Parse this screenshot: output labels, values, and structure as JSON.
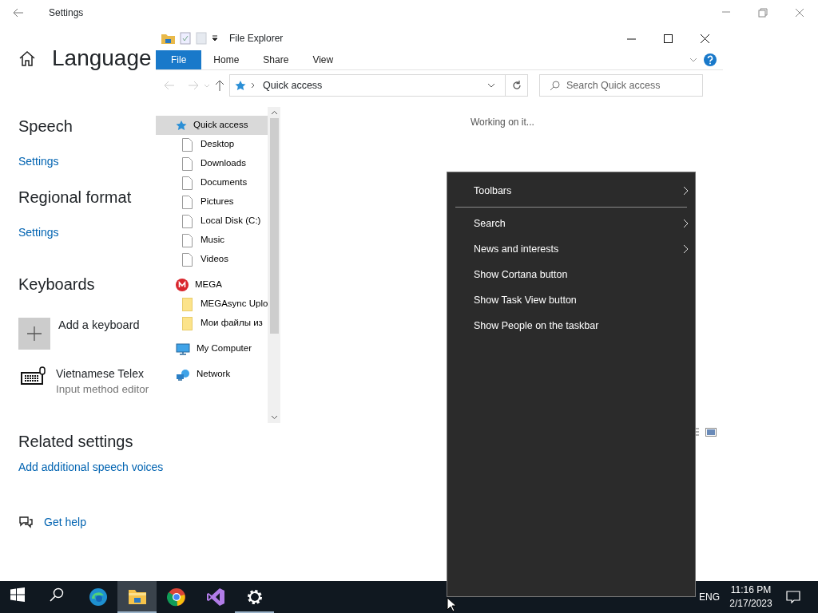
{
  "settings": {
    "title": "Settings",
    "heading": "Language",
    "items": [
      {
        "kind": "section",
        "text": "Speech"
      },
      {
        "kind": "link",
        "text": "Settings"
      },
      {
        "kind": "section",
        "text": "Regional format"
      },
      {
        "kind": "link",
        "text": "Settings"
      },
      {
        "kind": "section",
        "text": "Keyboards"
      },
      {
        "kind": "add",
        "text": "Add a keyboard"
      },
      {
        "kind": "keyboard",
        "text": "Vietnamese Telex",
        "subtext": "Input method editor"
      },
      {
        "kind": "section",
        "text": "Related settings"
      },
      {
        "kind": "link",
        "text": "Add additional speech voices"
      },
      {
        "kind": "help",
        "text": "Get help"
      }
    ]
  },
  "explorer": {
    "title": "File Explorer",
    "ribbon_tabs": [
      {
        "label": "File",
        "selected": true
      },
      {
        "label": "Home",
        "selected": false
      },
      {
        "label": "Share",
        "selected": false
      },
      {
        "label": "View",
        "selected": false
      }
    ],
    "address": "Quick access",
    "search_placeholder": "Search Quick access",
    "status": "Working on it...",
    "nav": [
      {
        "label": "Quick access",
        "selected": true,
        "children": [
          {
            "label": "Desktop",
            "selected": false
          },
          {
            "label": "Downloads",
            "selected": false
          },
          {
            "label": "Documents",
            "selected": false
          },
          {
            "label": "Pictures",
            "selected": false
          },
          {
            "label": "Local Disk (C:)",
            "selected": false
          },
          {
            "label": "Music",
            "selected": false
          },
          {
            "label": "Videos",
            "selected": false
          }
        ]
      },
      {
        "label": "MEGA",
        "selected": false,
        "children": [
          {
            "label": "MEGAsync Uplo",
            "selected": false
          },
          {
            "label": "Мои файлы из",
            "selected": false
          }
        ]
      },
      {
        "label": "My Computer",
        "selected": false
      },
      {
        "label": "Network",
        "selected": false
      }
    ]
  },
  "context_menu": {
    "items": [
      {
        "kind": "submenu",
        "label": "Toolbars"
      },
      {
        "kind": "separator"
      },
      {
        "kind": "submenu",
        "label": "Search"
      },
      {
        "kind": "submenu",
        "label": "News and interests"
      },
      {
        "kind": "command",
        "label": "Show Cortana button"
      },
      {
        "kind": "command",
        "label": "Show Task View button"
      },
      {
        "kind": "command",
        "label": "Show People on the taskbar"
      }
    ]
  },
  "taskbar": {
    "apps": [
      {
        "kind": "start",
        "selected": false,
        "running": false
      },
      {
        "kind": "search",
        "selected": false,
        "running": false
      },
      {
        "kind": "edge",
        "selected": false,
        "running": false
      },
      {
        "kind": "explorer",
        "selected": true,
        "running": true
      },
      {
        "kind": "chrome",
        "selected": false,
        "running": false
      },
      {
        "kind": "vs",
        "selected": false,
        "running": false
      },
      {
        "kind": "settings",
        "selected": false,
        "running": true
      }
    ],
    "language": "ENG",
    "time": "11:16 PM",
    "date": "2/17/2023"
  }
}
